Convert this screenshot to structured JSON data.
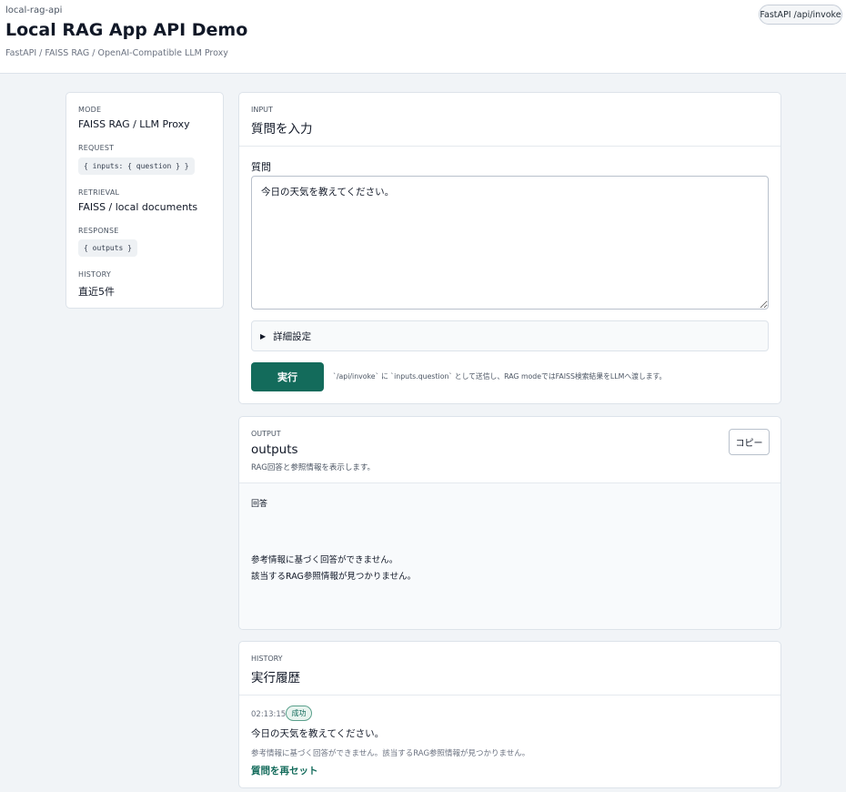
{
  "header": {
    "app_id": "local-rag-api",
    "title": "Local RAG App API Demo",
    "subtitle": "FastAPI / FAISS RAG / OpenAI-Compatible LLM Proxy",
    "endpoint_badge": "FastAPI /api/invoke"
  },
  "sidebar": {
    "mode_label": "MODE",
    "mode_value": "FAISS RAG / LLM Proxy",
    "request_label": "REQUEST",
    "request_code": "{ inputs: { question } }",
    "retrieval_label": "RETRIEVAL",
    "retrieval_value": "FAISS / local documents",
    "response_label": "RESPONSE",
    "response_code": "{ outputs }",
    "history_label": "HISTORY",
    "history_value": "直近5件"
  },
  "input": {
    "section_label": "INPUT",
    "title": "質問を入力",
    "question_label": "質問",
    "question_value": "今日の天気を教えてください。",
    "details_label": "詳細設定",
    "run_label": "実行",
    "run_note": "`/api/invoke` に `inputs.question` として送信し、RAG modeではFAISS検索結果をLLMへ渡します。"
  },
  "output": {
    "section_label": "OUTPUT",
    "title": "outputs",
    "subtitle": "RAG回答と参照情報を表示します。",
    "copy_label": "コピー",
    "answer_label": "回答",
    "answer_lines": [
      "参考情報に基づく回答ができません。",
      "該当するRAG参照情報が見つかりません。"
    ]
  },
  "history": {
    "section_label": "HISTORY",
    "title": "実行履歴",
    "items": [
      {
        "time": "02:13:15",
        "status": "成功",
        "question": "今日の天気を教えてください。",
        "answer": "参考情報に基づく回答ができません。該当するRAG参照情報が見つかりません。",
        "reset_label": "質問を再セット"
      }
    ]
  }
}
